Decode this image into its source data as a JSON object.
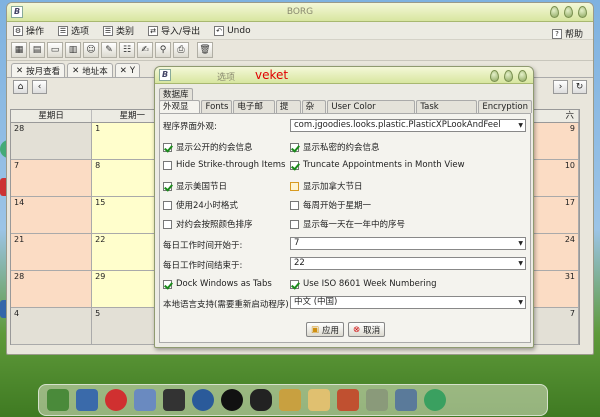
{
  "window": {
    "title": "BORG"
  },
  "menu": {
    "items": [
      "操作",
      "选项",
      "类别",
      "导入/导出",
      "Undo"
    ],
    "help": "帮助"
  },
  "tabs": [
    "按月查看",
    "地址本",
    "Y"
  ],
  "calendar": {
    "days": [
      "星期日",
      "星期一",
      "",
      "",
      "",
      "",
      ""
    ],
    "weeks": [
      [
        "28",
        "1",
        "",
        "",
        "",
        "",
        ""
      ],
      [
        "7",
        "8",
        "",
        "",
        "",
        "",
        ""
      ],
      [
        "14",
        "15",
        "",
        "",
        "",
        "",
        ""
      ],
      [
        "21",
        "22",
        "",
        "",
        "",
        "",
        ""
      ],
      [
        "28",
        "29",
        "",
        "",
        "",
        "",
        ""
      ],
      [
        "4",
        "5",
        "",
        "",
        "",
        "",
        ""
      ]
    ],
    "right_numbers": [
      "9",
      "10",
      "17",
      "24",
      "31",
      "7"
    ],
    "partial_text": "六"
  },
  "dialog": {
    "title": "选项",
    "title_red": "veket",
    "tab_row_top": [
      "数据库"
    ],
    "tabs": [
      "外观显示",
      "Fonts",
      "电子邮件",
      "提醒",
      "杂项",
      "User Color Scheme",
      "Task Options",
      "Encryption"
    ],
    "laf_label": "程序界面外观:",
    "laf_value": "com.jgoodies.looks.plastic.PlasticXPLookAndFeel",
    "checks": [
      {
        "label": "显示公开的约会信息",
        "checked": true
      },
      {
        "label": "显示私密的约会信息",
        "checked": true
      },
      {
        "label": "Hide Strike-through Items",
        "checked": false
      },
      {
        "label": "Truncate Appointments in Month View",
        "checked": true
      },
      {
        "label": "显示美国节日",
        "checked": true
      },
      {
        "label": "显示加拿大节日",
        "checked": false
      },
      {
        "label": "使用24小时格式",
        "checked": false
      },
      {
        "label": "每周开始于星期一",
        "checked": false
      },
      {
        "label": "对约会按照颜色排序",
        "checked": false
      },
      {
        "label": "显示每一天在一年中的序号",
        "checked": false
      }
    ],
    "start_label": "每日工作时间开始于:",
    "start_value": "7",
    "end_label": "每日工作时间结束于:",
    "end_value": "22",
    "dock_label": "Dock Windows as Tabs",
    "dock_checked": true,
    "iso_label": "Use ISO 8601 Week Numbering",
    "iso_checked": true,
    "locale_label": "本地语言支持(需要重新启动程序)",
    "locale_value": "中文 (中国)",
    "apply": "应用",
    "cancel": "取消"
  },
  "colors": {
    "titlebar": "#d8e6a0",
    "pink": "#fbdcc4",
    "yellow": "#fffecc",
    "gray": "#e3e0d6"
  }
}
